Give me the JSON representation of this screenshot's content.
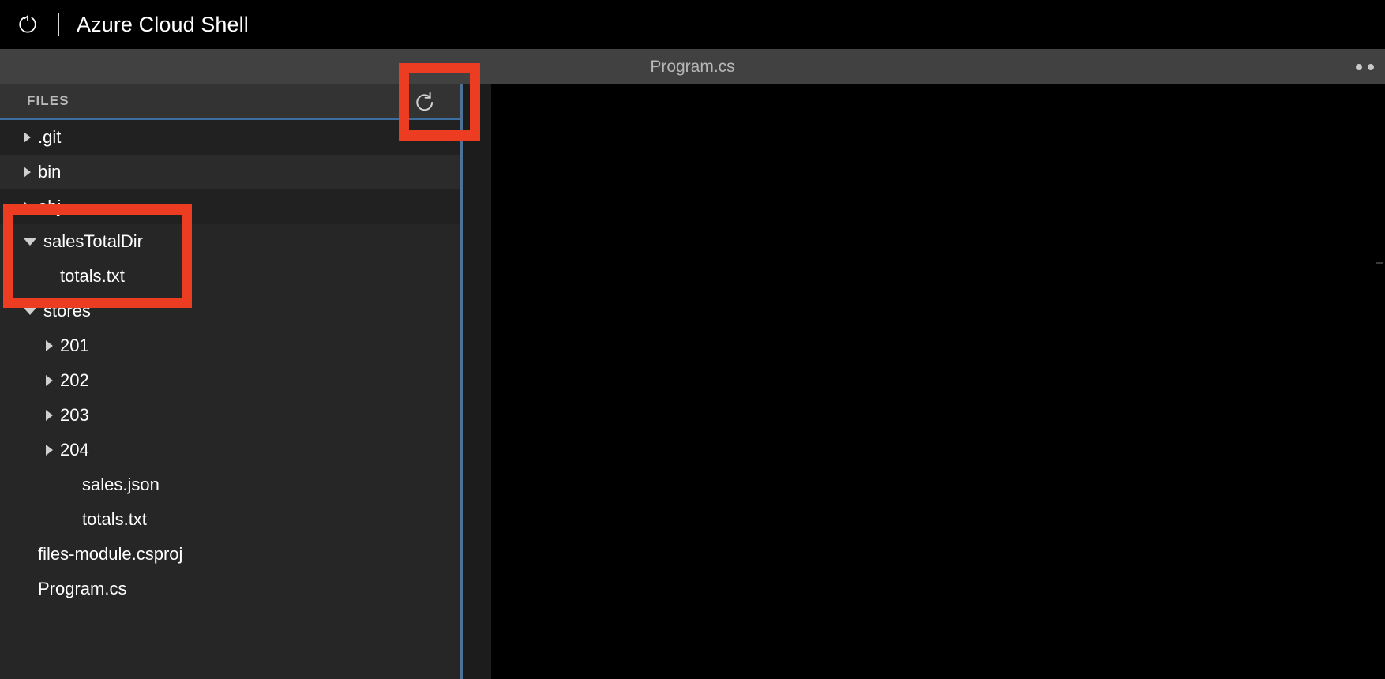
{
  "header": {
    "refresh_icon": "restart-icon",
    "title": "Azure Cloud Shell",
    "divider": "|"
  },
  "tabstrip": {
    "active_tab": "Program.cs",
    "overflow_icon": "ellipsis-icon"
  },
  "file_pane": {
    "title": "FILES",
    "refresh_icon": "refresh-icon",
    "tree": [
      {
        "label": ".git",
        "indent": 0,
        "state": "collapsed",
        "type": "folder",
        "shade": "shade-a"
      },
      {
        "label": "bin",
        "indent": 0,
        "state": "collapsed",
        "type": "folder",
        "shade": "shade-b"
      },
      {
        "label": "obj",
        "indent": 0,
        "state": "collapsed",
        "type": "folder",
        "shade": "shade-a"
      },
      {
        "label": "salesTotalDir",
        "indent": 0,
        "state": "expanded",
        "type": "folder",
        "shade": "shade-c"
      },
      {
        "label": "totals.txt",
        "indent": 1,
        "state": "leaf",
        "type": "file",
        "shade": "shade-c"
      },
      {
        "label": "stores",
        "indent": 0,
        "state": "expanded",
        "type": "folder",
        "shade": "shade-c"
      },
      {
        "label": "201",
        "indent": 1,
        "state": "collapsed",
        "type": "folder",
        "shade": "shade-c"
      },
      {
        "label": "202",
        "indent": 1,
        "state": "collapsed",
        "type": "folder",
        "shade": "shade-c"
      },
      {
        "label": "203",
        "indent": 1,
        "state": "collapsed",
        "type": "folder",
        "shade": "shade-c"
      },
      {
        "label": "204",
        "indent": 1,
        "state": "collapsed",
        "type": "folder",
        "shade": "shade-c"
      },
      {
        "label": "sales.json",
        "indent": 2,
        "state": "leaf",
        "type": "file",
        "shade": "shade-c"
      },
      {
        "label": "totals.txt",
        "indent": 2,
        "state": "leaf",
        "type": "file",
        "shade": "shade-c"
      },
      {
        "label": "files-module.csproj",
        "indent": 0,
        "state": "leaf",
        "type": "file",
        "shade": "shade-c"
      },
      {
        "label": "Program.cs",
        "indent": 0,
        "state": "leaf",
        "type": "file",
        "shade": "shade-c"
      }
    ]
  },
  "editor": {
    "content": ""
  },
  "annotations": [
    {
      "name": "refresh-button-callout",
      "color": "#ec3c22"
    },
    {
      "name": "salestotaldir-callout",
      "color": "#ec3c22"
    }
  ],
  "colors": {
    "accent_red": "#ec3c22",
    "accent_blue": "#3c6e9f",
    "tabstrip_bg": "#414141",
    "pane_bg": "#262626",
    "editor_bg": "#000000"
  }
}
